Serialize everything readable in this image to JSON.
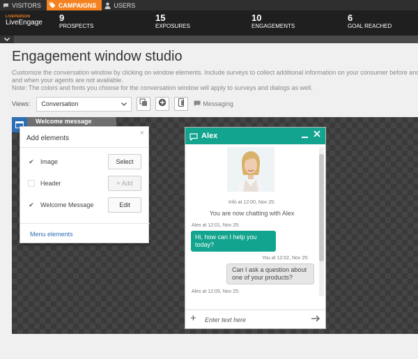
{
  "topnav": {
    "tabs": [
      {
        "label": "VISITORS",
        "icon": "chat-icon"
      },
      {
        "label": "CAMPAIGNS",
        "icon": "tag-icon",
        "active": true
      },
      {
        "label": "USERS",
        "icon": "user-icon"
      }
    ]
  },
  "brand": {
    "small": "LIVEPERSON",
    "name": "LiveEngage"
  },
  "stats": [
    {
      "num": "9",
      "label": "PROSPECTS"
    },
    {
      "num": "15",
      "label": "EXPOSURES"
    },
    {
      "num": "10",
      "label": "ENGAGEMENTS"
    },
    {
      "num": "6",
      "label": "GOAL REACHED"
    }
  ],
  "page": {
    "title": "Engagement window studio",
    "desc1": "Customize the conversation window by clicking on window elements. Include surveys to collect additional information on your consumer before and a",
    "desc2": "and when your agents are not available.",
    "desc3": "Note: The colors and fonts you choose for the conversation window will apply to surveys and dialogs as well."
  },
  "views": {
    "label": "Views:",
    "selected": "Conversation",
    "messaging": "Messaging"
  },
  "welcome_tab": "Welcome message",
  "panel": {
    "title": "Add elements",
    "rows": [
      {
        "label": "Image",
        "checked": true,
        "button": "Select"
      },
      {
        "label": "Header",
        "checked": false,
        "button": "+ Add"
      },
      {
        "label": "Welcome Message",
        "checked": true,
        "button": "Edit"
      }
    ],
    "footer_link": "Menu elements"
  },
  "chat": {
    "agent": "Alex",
    "info": "Info at 12:00, Nov 25:",
    "now_chatting": "You are now chatting with Alex",
    "msg1_meta": "Alex at 12:01, Nov 25:",
    "msg1": "Hi, how can I help you today?",
    "msg2_meta": "You at 12:02, Nov 25:",
    "msg2": "Can I ask a question about one of your products?",
    "msg3_meta": "Alex at 12:05, Nov 25:",
    "input_placeholder": "Enter text here"
  },
  "colors": {
    "accent": "#f58220",
    "chat_header": "#12a48e",
    "link": "#2e6fb5"
  }
}
